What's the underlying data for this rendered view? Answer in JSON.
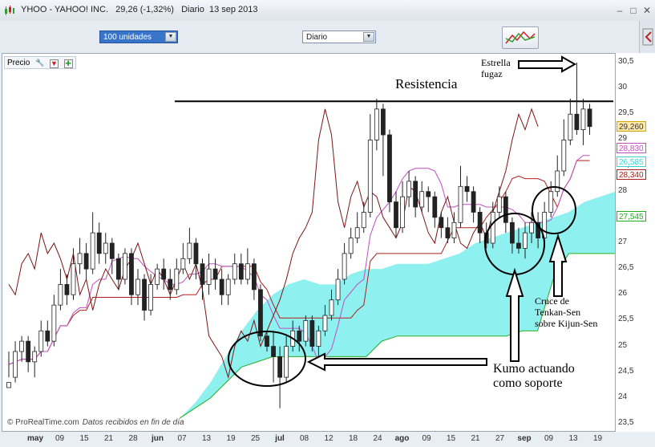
{
  "window": {
    "title": "YHOO - YAHOO! INC.",
    "price_text": "29,26 (-1,32%)",
    "period": "Diario",
    "date": "13 sep 2013"
  },
  "toolbar": {
    "units_select": "100 unidades",
    "period_select": "Diario"
  },
  "panel": {
    "label": "Precio"
  },
  "footer": {
    "source": "© ProRealTime.com",
    "note": "Datos recibidos en fin de día"
  },
  "annotations": {
    "resistance": "Resistencia",
    "shooting_star": "Estrella fugaz",
    "kumo_support_line1": "Kumo actuando",
    "kumo_support_line2": "como soporte",
    "cross_line1": "Cruce de",
    "cross_line2": "Tenkan-Sen",
    "cross_line3": "sobre Kijun-Sen"
  },
  "price_tags": {
    "close": "29,260",
    "tenkan": "28,830",
    "senkou": "26,585",
    "kijun": "28,340",
    "senkou_b": "27,545"
  },
  "colors": {
    "close": "#d9a400",
    "tenkan": "#c04fc0",
    "senkou": "#3cd3d6",
    "kijun": "#b01e1e",
    "senkou_b": "#22b022",
    "cloud_bear": "#8ff0f0",
    "cloud_bull": "#90e070",
    "chikou": "#7a1515"
  },
  "chart_data": {
    "type": "candlestick",
    "ylim": [
      23.5,
      30.5
    ],
    "y_ticks": [
      "30,5",
      "30",
      "29,5",
      "29",
      "28,5",
      "28",
      "27,5",
      "27",
      "26,5",
      "26",
      "25,5",
      "25",
      "24,5",
      "24",
      "23,5"
    ],
    "x_ticks": [
      "may",
      "09",
      "15",
      "21",
      "28",
      "jun",
      "07",
      "13",
      "19",
      "25",
      "jul",
      "08",
      "12",
      "18",
      "24",
      "ago",
      "09",
      "15",
      "21",
      "27",
      "sep",
      "09",
      "13",
      "19"
    ],
    "resistance_level": 29.75,
    "candles": [
      [
        24.2,
        24.3,
        24.9,
        24.4
      ],
      [
        24.4,
        24.9,
        25.1,
        24.3
      ],
      [
        24.9,
        25.1,
        25.2,
        24.7
      ],
      [
        25.1,
        24.7,
        25.2,
        24.5
      ],
      [
        24.7,
        24.9,
        25.0,
        24.4
      ],
      [
        24.9,
        25.3,
        25.5,
        24.8
      ],
      [
        25.3,
        25.1,
        25.5,
        25.0
      ],
      [
        25.1,
        25.8,
        26.0,
        25.0
      ],
      [
        25.8,
        26.2,
        26.5,
        25.7
      ],
      [
        26.2,
        26.0,
        26.4,
        25.8
      ],
      [
        26.0,
        26.6,
        26.9,
        25.9
      ],
      [
        26.6,
        26.8,
        27.1,
        26.4
      ],
      [
        26.8,
        26.5,
        27.0,
        26.3
      ],
      [
        26.5,
        27.2,
        27.6,
        26.4
      ],
      [
        27.2,
        26.8,
        27.4,
        26.6
      ],
      [
        26.8,
        27.0,
        27.2,
        26.6
      ],
      [
        27.0,
        26.7,
        27.1,
        26.4
      ],
      [
        26.7,
        26.3,
        26.8,
        26.1
      ],
      [
        26.3,
        26.8,
        26.9,
        26.2
      ],
      [
        26.8,
        26.0,
        26.9,
        25.8
      ],
      [
        26.0,
        26.3,
        26.5,
        25.8
      ],
      [
        26.3,
        25.7,
        26.4,
        25.5
      ],
      [
        25.7,
        26.2,
        26.4,
        25.6
      ],
      [
        26.2,
        26.5,
        26.6,
        26.1
      ],
      [
        26.5,
        26.3,
        26.7,
        26.1
      ],
      [
        26.3,
        26.1,
        26.5,
        25.9
      ],
      [
        26.1,
        26.5,
        26.7,
        26.0
      ],
      [
        26.5,
        26.7,
        27.0,
        26.4
      ],
      [
        26.7,
        27.0,
        27.3,
        26.6
      ],
      [
        27.0,
        26.6,
        27.1,
        26.3
      ],
      [
        26.6,
        26.2,
        26.7,
        25.9
      ],
      [
        26.2,
        26.5,
        26.8,
        26.0
      ],
      [
        26.5,
        26.3,
        26.7,
        26.1
      ],
      [
        26.3,
        26.0,
        26.5,
        25.8
      ],
      [
        26.0,
        26.3,
        26.4,
        25.8
      ],
      [
        26.3,
        26.6,
        26.8,
        26.2
      ],
      [
        26.6,
        26.3,
        26.8,
        26.2
      ],
      [
        26.3,
        26.6,
        26.9,
        26.2
      ],
      [
        26.6,
        26.1,
        26.7,
        25.9
      ],
      [
        26.1,
        25.2,
        26.2,
        25.1
      ],
      [
        25.2,
        25.0,
        25.3,
        24.9
      ],
      [
        25.0,
        24.8,
        25.3,
        24.3
      ],
      [
        24.8,
        24.4,
        25.0,
        23.8
      ],
      [
        24.4,
        25.0,
        25.2,
        24.3
      ],
      [
        25.0,
        25.3,
        25.5,
        24.9
      ],
      [
        25.3,
        25.1,
        25.4,
        24.9
      ],
      [
        25.1,
        25.5,
        25.6,
        25.0
      ],
      [
        25.5,
        25.0,
        25.6,
        24.9
      ],
      [
        25.0,
        25.3,
        25.4,
        24.8
      ],
      [
        25.3,
        25.6,
        25.8,
        25.2
      ],
      [
        25.6,
        25.9,
        26.1,
        25.5
      ],
      [
        25.9,
        26.3,
        26.5,
        25.8
      ],
      [
        26.3,
        26.8,
        27.0,
        26.2
      ],
      [
        26.8,
        27.1,
        27.3,
        26.7
      ],
      [
        27.1,
        27.3,
        27.6,
        27.0
      ],
      [
        27.3,
        27.6,
        27.8,
        27.2
      ],
      [
        27.6,
        29.0,
        29.5,
        27.5
      ],
      [
        29.0,
        29.6,
        29.8,
        28.8
      ],
      [
        29.6,
        29.1,
        29.7,
        28.3
      ],
      [
        29.1,
        27.8,
        29.2,
        27.6
      ],
      [
        27.8,
        27.3,
        28.0,
        27.1
      ],
      [
        27.3,
        27.9,
        28.2,
        27.2
      ],
      [
        27.9,
        28.2,
        28.4,
        27.7
      ],
      [
        28.2,
        27.7,
        28.3,
        27.5
      ],
      [
        27.7,
        28.0,
        28.2,
        27.6
      ],
      [
        28.0,
        27.9,
        28.1,
        27.6
      ],
      [
        27.9,
        27.5,
        28.0,
        27.3
      ],
      [
        27.5,
        27.3,
        27.6,
        27.1
      ],
      [
        27.3,
        27.1,
        27.5,
        27.0
      ],
      [
        27.1,
        27.4,
        27.6,
        27.0
      ],
      [
        27.4,
        28.1,
        28.5,
        27.3
      ],
      [
        28.1,
        28.0,
        28.3,
        27.8
      ],
      [
        28.0,
        27.6,
        28.1,
        27.4
      ],
      [
        27.6,
        27.2,
        27.7,
        27.0
      ],
      [
        27.2,
        27.0,
        27.4,
        26.9
      ],
      [
        27.0,
        27.6,
        27.8,
        26.9
      ],
      [
        27.6,
        27.9,
        28.1,
        27.5
      ],
      [
        27.9,
        27.4,
        28.0,
        27.2
      ],
      [
        27.4,
        27.0,
        27.5,
        26.8
      ],
      [
        27.0,
        26.9,
        27.3,
        26.8
      ],
      [
        26.9,
        27.2,
        27.4,
        26.7
      ],
      [
        27.2,
        27.4,
        27.6,
        27.0
      ],
      [
        27.4,
        27.1,
        27.6,
        26.9
      ],
      [
        27.1,
        27.6,
        27.8,
        27.0
      ],
      [
        27.6,
        28.0,
        28.2,
        27.5
      ],
      [
        28.0,
        28.4,
        28.7,
        27.9
      ],
      [
        28.4,
        29.0,
        29.4,
        28.3
      ],
      [
        29.0,
        29.5,
        29.8,
        28.9
      ],
      [
        29.5,
        29.2,
        30.5,
        29.1
      ],
      [
        29.2,
        29.6,
        29.8,
        28.9
      ],
      [
        29.6,
        29.26,
        29.7,
        29.1
      ]
    ]
  }
}
